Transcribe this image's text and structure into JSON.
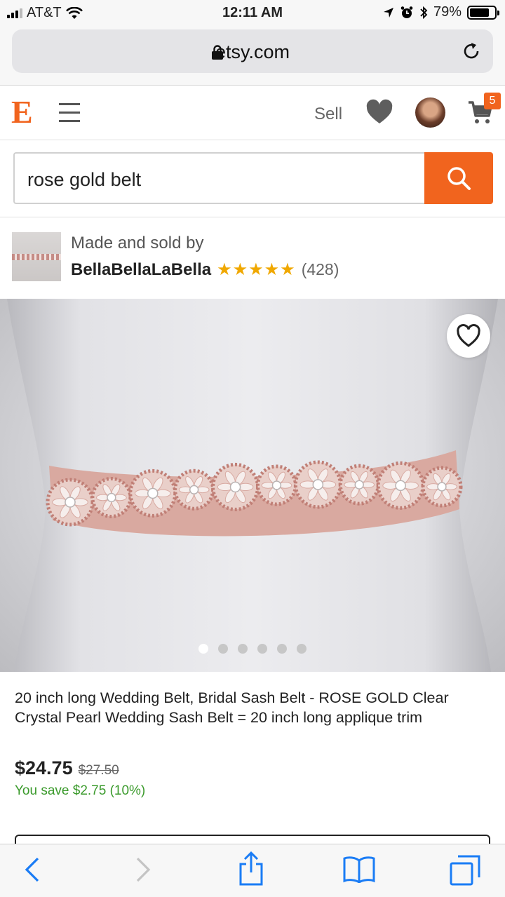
{
  "status_bar": {
    "carrier": "AT&T",
    "time": "12:11 AM",
    "battery": "79%",
    "battery_level": 0.79
  },
  "browser": {
    "url": "etsy.com",
    "icons": [
      "lock-icon",
      "reload-icon"
    ]
  },
  "header": {
    "logo": "E",
    "sell_label": "Sell",
    "cart_count": "5",
    "icons": [
      "hamburger-menu-icon",
      "favorites-heart-icon",
      "user-avatar",
      "cart-icon"
    ]
  },
  "search": {
    "value": "rose gold belt",
    "icon": "search-icon"
  },
  "seller": {
    "made_by": "Made and sold by",
    "shop_name": "BellaBellaLaBella",
    "stars": "★★★★★",
    "rating": 5,
    "reviews": "(428)"
  },
  "product": {
    "image_count": 6,
    "active_image": 1,
    "title": "20 inch long Wedding Belt, Bridal Sash Belt - ROSE GOLD Clear Crystal Pearl Wedding Sash Belt = 20 inch long applique trim",
    "price": "$24.75",
    "old_price": "$27.50",
    "savings": "You save $2.75 (10%)"
  },
  "toolbar": {
    "icons": [
      "back-icon",
      "forward-icon",
      "share-icon",
      "bookmarks-icon",
      "tabs-icon"
    ]
  },
  "colors": {
    "brand_orange": "#f1641e",
    "star_gold": "#f0a800",
    "savings_green": "#3a9a2b"
  }
}
